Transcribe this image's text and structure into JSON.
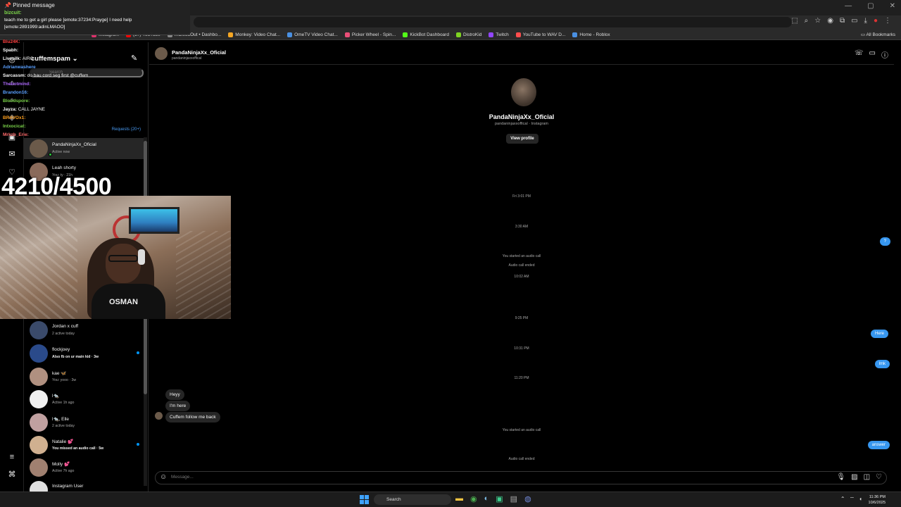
{
  "browser": {
    "bookmarks": [
      {
        "label": "Instagram",
        "color": "#e1306c"
      },
      {
        "label": "(37) YouTube",
        "color": "#ff0000"
      },
      {
        "label": "InCloudOut • Dashbo...",
        "color": "#888888"
      },
      {
        "label": "Monkey: Video Chat...",
        "color": "#f5a623"
      },
      {
        "label": "OmeTV Video Chat...",
        "color": "#4a90e2"
      },
      {
        "label": "Picker Wheel - Spin...",
        "color": "#e94e77"
      },
      {
        "label": "KickBot Dashboard",
        "color": "#53fc18"
      },
      {
        "label": "DistroKid",
        "color": "#7ed321"
      },
      {
        "label": "Twitch",
        "color": "#9146ff"
      },
      {
        "label": "YouTube to WAV D...",
        "color": "#ff4d4d"
      },
      {
        "label": "Home - Roblox",
        "color": "#4a90e2"
      }
    ],
    "all_bookmarks": "All Bookmarks"
  },
  "stream": {
    "pinned": {
      "title": "Pinned message",
      "user": "bizcuit:",
      "text": "teach me to get a girl please [emote:37234:Prayge] I need help [emote:2891999:adinLMAOO]"
    },
    "chat": [
      {
        "user": "Blu24K:",
        "msg": "",
        "color": "#ff4040"
      },
      {
        "user": "Spabh:",
        "msg": "",
        "color": "#ffffff"
      },
      {
        "user": "Livesilk:",
        "msg": "AIRO",
        "color": "#ffffff"
      },
      {
        "user": "Adrianwashere",
        "msg": "",
        "color": "#5aa0ff"
      },
      {
        "user": "Sarcassm:",
        "msg": "do bau cord seg first @cuffem",
        "color": "#ffffff"
      },
      {
        "user": "Thebotmind:",
        "msg": "",
        "color": "#b06aff"
      },
      {
        "user": "Brandon16:",
        "msg": "",
        "color": "#5aa0ff"
      },
      {
        "user": "Bloodspore:",
        "msg": "",
        "color": "#7bd44a"
      },
      {
        "user": "Jayza:",
        "msg": "CALL JAYNE",
        "color": "#ffffff"
      },
      {
        "user": "BRAVOx1:",
        "msg": "",
        "color": "#ff9f1c"
      },
      {
        "user": "Intxocicat:",
        "msg": "",
        "color": "#7bd44a"
      },
      {
        "user": "Mrkzb_Erie:",
        "msg": "",
        "color": "#ff6a6a"
      }
    ],
    "sub_counter": "4210/4500",
    "webcam_shirt": "OSMAN"
  },
  "instagram": {
    "username": "cuffemspam",
    "search_placeholder": "Search",
    "requests": "Requests (20+)",
    "conversations": [
      {
        "name": "PandaNinjaXx_Oficial",
        "sub": "Active now",
        "active": true,
        "online": true,
        "unread": false,
        "color": "#6b5a4a"
      },
      {
        "name": "Leah shorty",
        "sub": "You: ty · 21h",
        "active": false,
        "online": false,
        "unread": false,
        "color": "#8a6a5a"
      },
      {
        "name": "Jordan x cuff",
        "sub": "2 active today",
        "active": false,
        "online": false,
        "unread": false,
        "color": "#3a4a6a"
      },
      {
        "name": "flockjoey",
        "sub": "Also fb on ur main kid · 3w",
        "active": false,
        "online": false,
        "unread": true,
        "color": "#2a4a8a"
      },
      {
        "name": "kae 🦋",
        "sub": "You: yooo · 3w",
        "active": false,
        "online": false,
        "unread": false,
        "color": "#b09080"
      },
      {
        "name": "l🐀",
        "sub": "Active 1h ago",
        "active": false,
        "online": false,
        "unread": false,
        "color": "#f0f0f0"
      },
      {
        "name": "l🐀, Elle",
        "sub": "2 active today",
        "active": false,
        "online": false,
        "unread": false,
        "color": "#c0a0a0"
      },
      {
        "name": "Natalie 💕",
        "sub": "You missed an audio call · 5w",
        "active": false,
        "online": false,
        "unread": true,
        "color": "#d0b090"
      },
      {
        "name": "Molly 💕",
        "sub": "Active 7h ago",
        "active": false,
        "online": false,
        "unread": false,
        "color": "#a08070"
      },
      {
        "name": "Instagram User",
        "sub": "",
        "active": false,
        "online": false,
        "unread": false,
        "color": "#e0e0e0"
      }
    ],
    "chat": {
      "name": "PandaNinjaXx_Oficial",
      "handle": "pandaninjaxxoffical",
      "profile_sub": "pandaninjaxxoffical · Instagram",
      "view_profile": "View profile",
      "timestamps": [
        "Fri 3:01 PM",
        "3:30 AM",
        "10:02 AM",
        "9:25 PM",
        "10:31 PM",
        "11:20 PM"
      ],
      "system": [
        "You started an audio call",
        "Audio call ended",
        "You started an audio call",
        "Audio call ended"
      ],
      "incoming": [
        "Heyy",
        "I'm here",
        "Cuffem follow me back"
      ],
      "outgoing": [
        "?",
        "Here",
        "lmk",
        "answer"
      ],
      "composer_placeholder": "Message..."
    }
  },
  "taskbar": {
    "search": "Search",
    "time": "11:36 PM",
    "date": "10/6/2025"
  }
}
